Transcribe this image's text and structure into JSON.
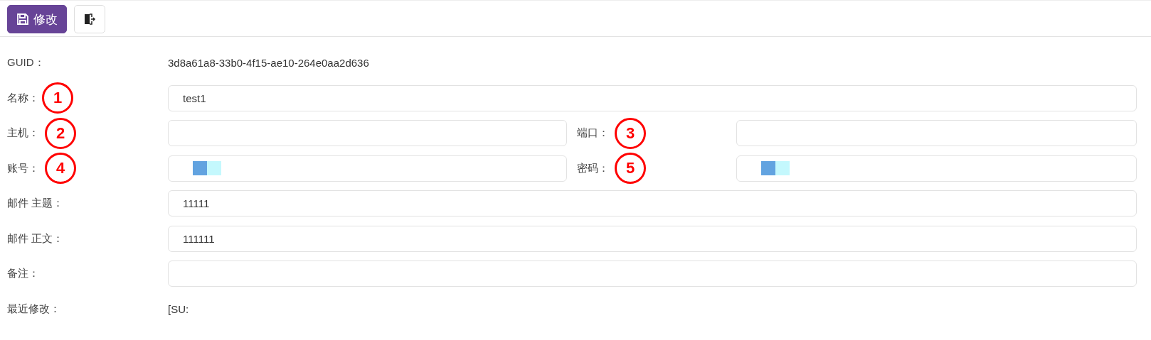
{
  "toolbar": {
    "buttons": [
      {
        "kind": "save",
        "label": "修改"
      },
      {
        "kind": "exit"
      }
    ]
  },
  "rows": [
    {
      "kind": "text",
      "label": "GUID：",
      "value": "3d8a61a8-33b0-4f15-ae10-264e0aa2d636"
    },
    {
      "kind": "field",
      "label": "名称：",
      "marker": "1",
      "value": "test1"
    },
    {
      "kind": "pair",
      "fields": [
        {
          "label": "主机：",
          "marker": "2",
          "masked": false
        },
        {
          "label": "端口：",
          "marker": "3",
          "masked": false
        }
      ]
    },
    {
      "kind": "pair",
      "fields": [
        {
          "label": "账号：",
          "marker": "4",
          "masked": true
        },
        {
          "label": "密码：",
          "marker": "5",
          "masked": true
        }
      ]
    },
    {
      "kind": "field",
      "label": "邮件 主题：",
      "value": "11111"
    },
    {
      "kind": "field",
      "label": "邮件 正文：",
      "value": "111111"
    },
    {
      "kind": "field",
      "label": "备注："
    },
    {
      "kind": "text",
      "label": "最近修改：",
      "value": "[SU:"
    }
  ]
}
